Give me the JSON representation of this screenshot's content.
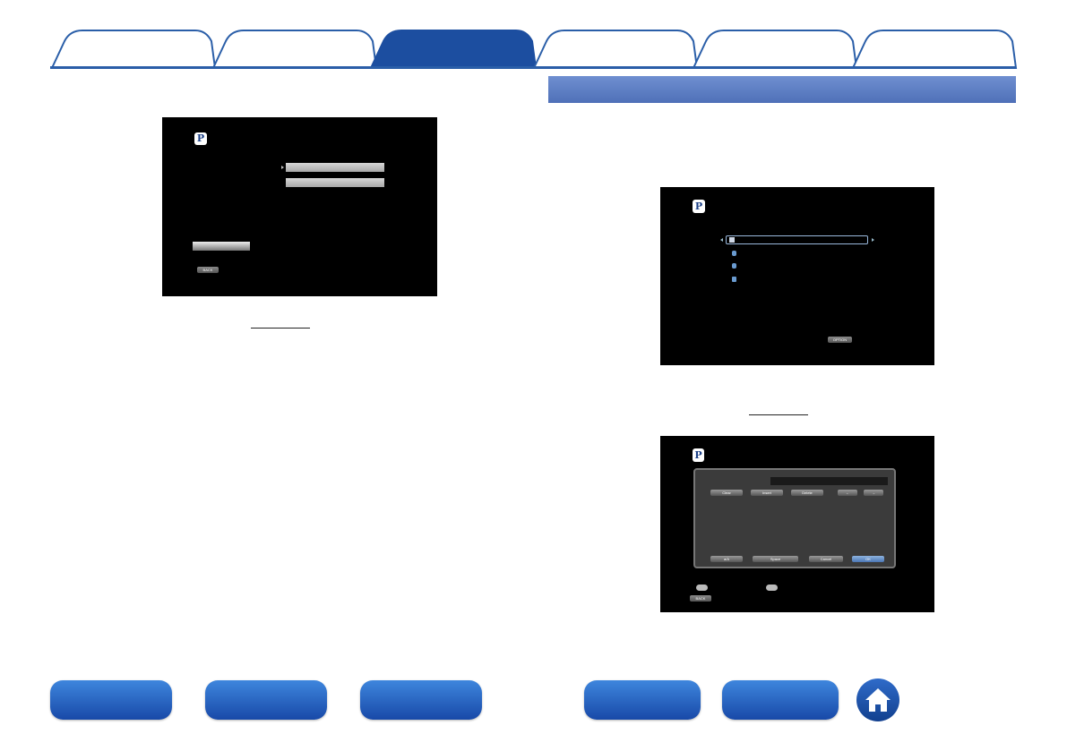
{
  "tabs": [
    {
      "label": ""
    },
    {
      "label": ""
    },
    {
      "label": ""
    },
    {
      "label": ""
    },
    {
      "label": ""
    },
    {
      "label": ""
    }
  ],
  "section_bar": {
    "title": ""
  },
  "screen1": {
    "back_label": "BACK"
  },
  "screen2": {
    "option_label": "OPTION"
  },
  "screen3": {
    "buttons_top": [
      "Clear",
      "Insert",
      "Delete",
      "←",
      "→"
    ],
    "buttons_bottom": [
      "a/A",
      "Space",
      "Cancel",
      "OK"
    ],
    "back_label": "BACK"
  },
  "colors": {
    "tab_active": "#1c4ea0",
    "tab_inactive_border": "#2a5ea8",
    "section_bar": "#5577bf",
    "nav_button": "#2563c4"
  },
  "icons": {
    "home": "home-icon",
    "logo": "pandora-p-icon"
  }
}
